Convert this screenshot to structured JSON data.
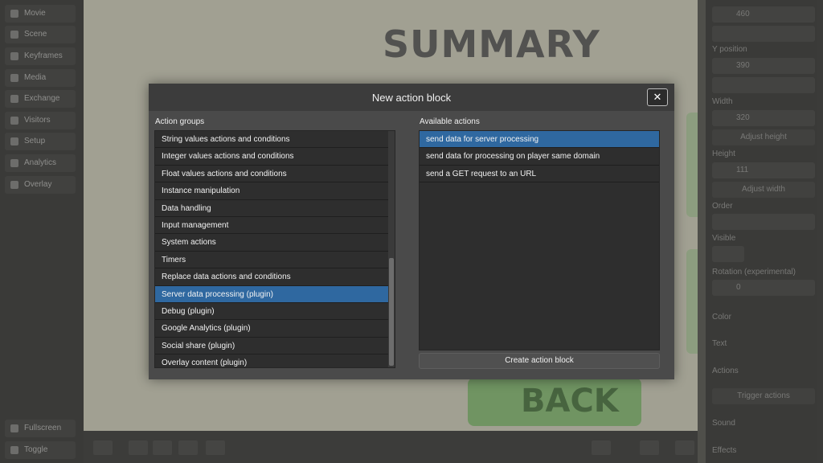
{
  "background": {
    "left_sidebar_items": [
      "Movie",
      "Scene",
      "Keyframes",
      "Media",
      "Exchange",
      "Visitors",
      "Setup",
      "Analytics",
      "Overlay"
    ],
    "left_sidebar_bottom": [
      "Fullscreen",
      "Toggle"
    ],
    "canvas_title": "SUMMARY",
    "canvas_back": "BACK",
    "right_panel": {
      "value_top": "460",
      "y_label": "Y position",
      "y_value": "390",
      "width_label": "Width",
      "width_value": "320",
      "adjust_height": "Adjust height",
      "height_label": "Height",
      "height_value": "111",
      "adjust_width": "Adjust width",
      "order_label": "Order",
      "visible_label": "Visible",
      "rotation_label": "Rotation (experimental)",
      "rotation_value": "0",
      "color_label": "Color",
      "text_label": "Text",
      "actions_label": "Actions",
      "trigger_actions": "Trigger actions",
      "sound_label": "Sound",
      "effects_label": "Effects"
    }
  },
  "modal": {
    "title": "New action block",
    "close_icon": "close-icon",
    "groups_label": "Action groups",
    "actions_label": "Available actions",
    "groups": [
      {
        "label": "String values actions and conditions"
      },
      {
        "label": "Integer values actions and conditions"
      },
      {
        "label": "Float values actions and conditions"
      },
      {
        "label": "Instance manipulation"
      },
      {
        "label": "Data handling"
      },
      {
        "label": "Input management"
      },
      {
        "label": "System actions"
      },
      {
        "label": "Timers"
      },
      {
        "label": "Replace data actions and conditions"
      },
      {
        "label": "Server data processing (plugin)"
      },
      {
        "label": "Debug (plugin)"
      },
      {
        "label": "Google Analytics (plugin)"
      },
      {
        "label": "Social share (plugin)"
      },
      {
        "label": "Overlay content (plugin)"
      }
    ],
    "selected_group": "Server data processing (plugin)",
    "actions": [
      {
        "label": "send data for server processing"
      },
      {
        "label": "send data for processing on player same domain"
      },
      {
        "label": "send a GET request to an URL"
      }
    ],
    "selected_action": "send data for server processing",
    "create_label": "Create action block",
    "selection_color": "#2f68a0"
  }
}
